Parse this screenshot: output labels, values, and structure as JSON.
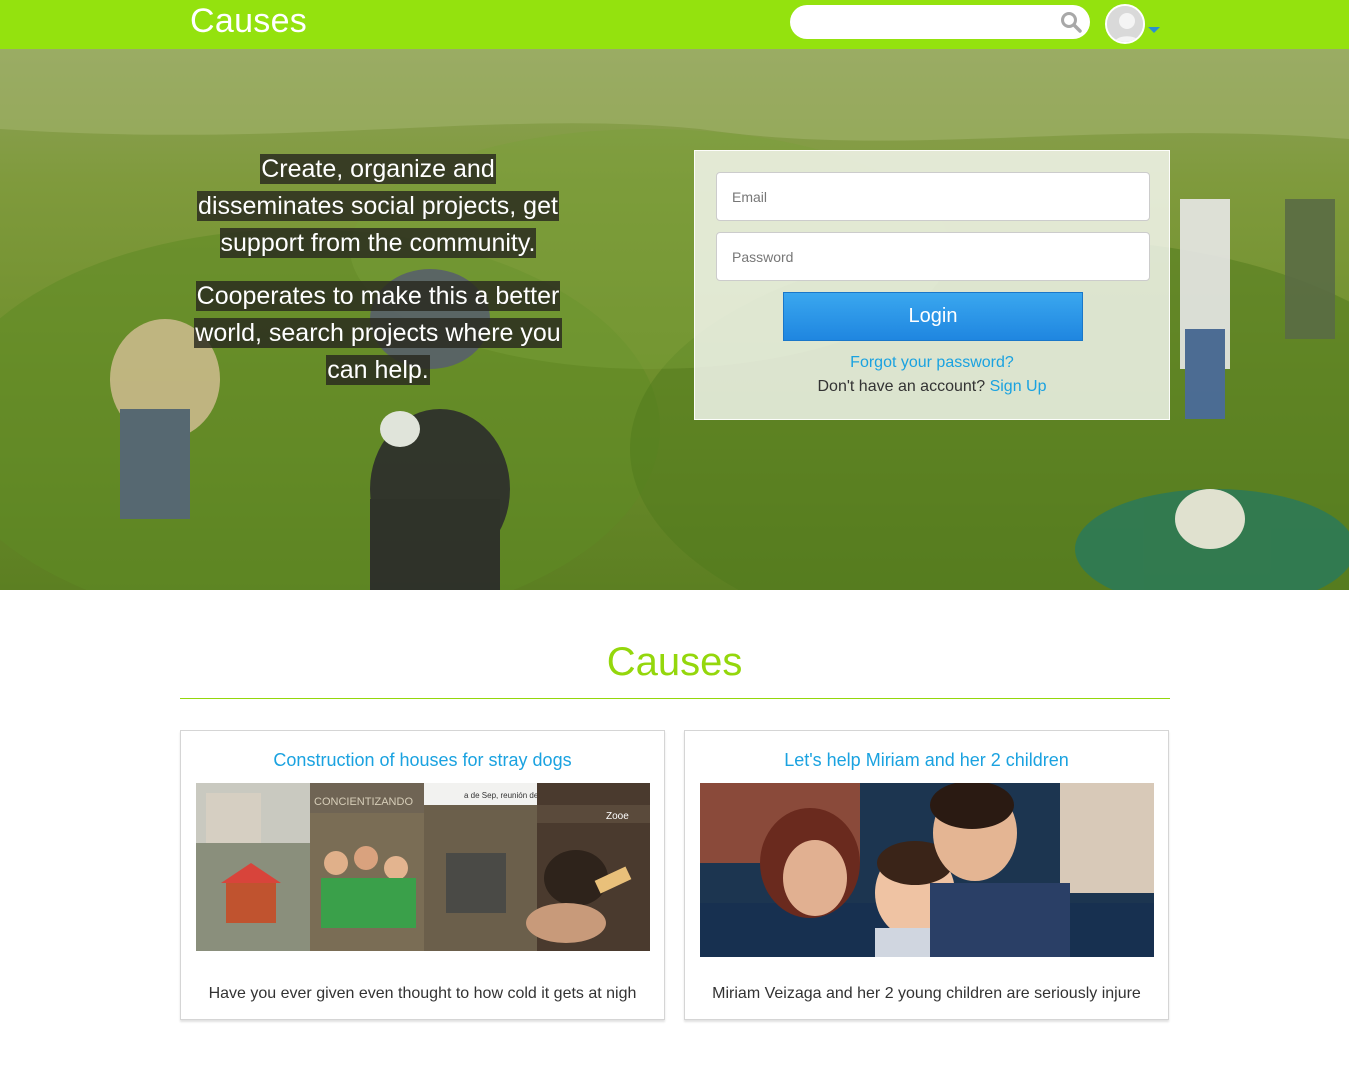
{
  "header": {
    "brand": "Causes",
    "search_placeholder": "",
    "accent_color": "#94e20e"
  },
  "hero": {
    "tagline_1": "Create, organize and disseminates social projects, get support from the community.",
    "tagline_2": "Cooperates to make this a better world, search projects where you can help."
  },
  "login": {
    "email_placeholder": "Email",
    "password_placeholder": "Password",
    "button_label": "Login",
    "forgot_link": "Forgot your password?",
    "no_account_text": "Don't have an account?",
    "signup_link": "Sign Up"
  },
  "causes": {
    "section_title": "Causes",
    "cards": [
      {
        "title": "Construction of houses for stray dogs",
        "description": "Have you ever given even thought to how cold it gets at nigh",
        "image_caption_1": "CONCIENTIZANDO",
        "image_caption_2": "a de Sep, reunión de nuevos voluntarios",
        "image_logo": "Zooe"
      },
      {
        "title": "Let's help Miriam and her 2 children",
        "description": "Miriam Veizaga and her 2 young children are seriously injure"
      }
    ]
  }
}
